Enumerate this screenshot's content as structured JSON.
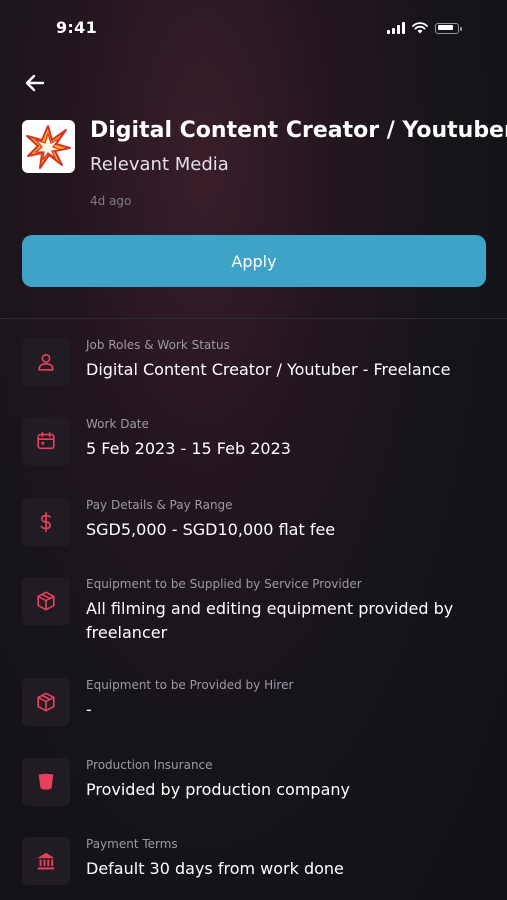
{
  "status_bar": {
    "time": "9:41"
  },
  "job": {
    "title": "Digital Content Creator / Youtuber",
    "company": "Relevant Media",
    "posted": "4d ago"
  },
  "apply_label": "Apply",
  "colors": {
    "accent": "#3fa2c7",
    "icon": "#e8405a"
  },
  "details": [
    {
      "icon": "user-icon",
      "label": "Job Roles & Work Status",
      "value": "Digital Content Creator / Youtuber - Freelance"
    },
    {
      "icon": "calendar-icon",
      "label": "Work Date",
      "value": "5 Feb 2023 - 15 Feb 2023"
    },
    {
      "icon": "dollar-icon",
      "label": "Pay Details & Pay Range",
      "value": "SGD5,000 - SGD10,000 flat fee"
    },
    {
      "icon": "box-icon",
      "label": "Equipment to be Supplied by Service Provider",
      "value": "All filming and editing equipment provided by freelancer"
    },
    {
      "icon": "box-icon",
      "label": "Equipment to be Provided by Hirer",
      "value": "-"
    },
    {
      "icon": "shield-icon",
      "label": "Production Insurance",
      "value": "Provided by production company"
    },
    {
      "icon": "bank-icon",
      "label": "Payment Terms",
      "value": "Default 30 days from work done"
    }
  ]
}
